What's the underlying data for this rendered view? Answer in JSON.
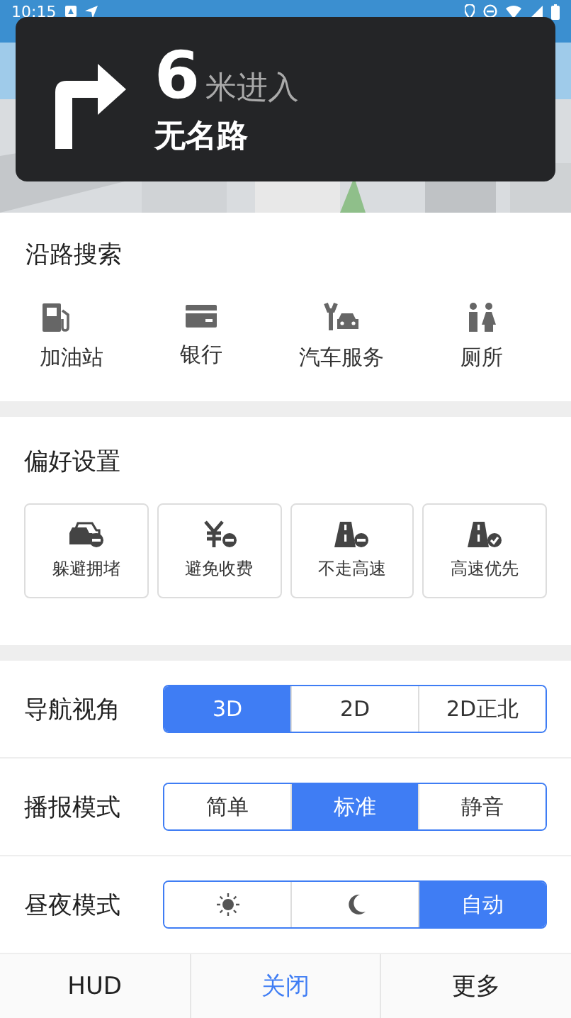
{
  "status_bar": {
    "time": "10:15"
  },
  "guidance": {
    "distance": "6",
    "unit": "米进入",
    "road": "无名路"
  },
  "along_route_search": {
    "title": "沿路搜索",
    "items": [
      {
        "label": "加油站",
        "kind": "fuel"
      },
      {
        "label": "银行",
        "kind": "bank"
      },
      {
        "label": "汽车服务",
        "kind": "carservice"
      },
      {
        "label": "厕所",
        "kind": "toilet"
      }
    ]
  },
  "preferences": {
    "title": "偏好设置",
    "items": [
      {
        "label": "躲避拥堵",
        "kind": "congestion",
        "selected": false
      },
      {
        "label": "避免收费",
        "kind": "toll",
        "selected": false
      },
      {
        "label": "不走高速",
        "kind": "nohighway",
        "selected": false
      },
      {
        "label": "高速优先",
        "kind": "highway",
        "selected": false
      }
    ]
  },
  "settings": [
    {
      "label": "导航视角",
      "options": [
        {
          "kind": "text",
          "label": "3D",
          "selected": true
        },
        {
          "kind": "text",
          "label": "2D",
          "selected": false
        },
        {
          "kind": "text",
          "label": "2D正北",
          "selected": false
        }
      ]
    },
    {
      "label": "播报模式",
      "options": [
        {
          "kind": "text",
          "label": "简单",
          "selected": false
        },
        {
          "kind": "text",
          "label": "标准",
          "selected": true
        },
        {
          "kind": "text",
          "label": "静音",
          "selected": false
        }
      ]
    },
    {
      "label": "昼夜模式",
      "options": [
        {
          "kind": "sun",
          "selected": false
        },
        {
          "kind": "moon",
          "selected": false
        },
        {
          "kind": "text",
          "label": "自动",
          "selected": true
        }
      ]
    }
  ],
  "bottom_bar": [
    {
      "label": "HUD",
      "kind": "normal"
    },
    {
      "label": "关闭",
      "kind": "accent"
    },
    {
      "label": "更多",
      "kind": "normal"
    }
  ]
}
